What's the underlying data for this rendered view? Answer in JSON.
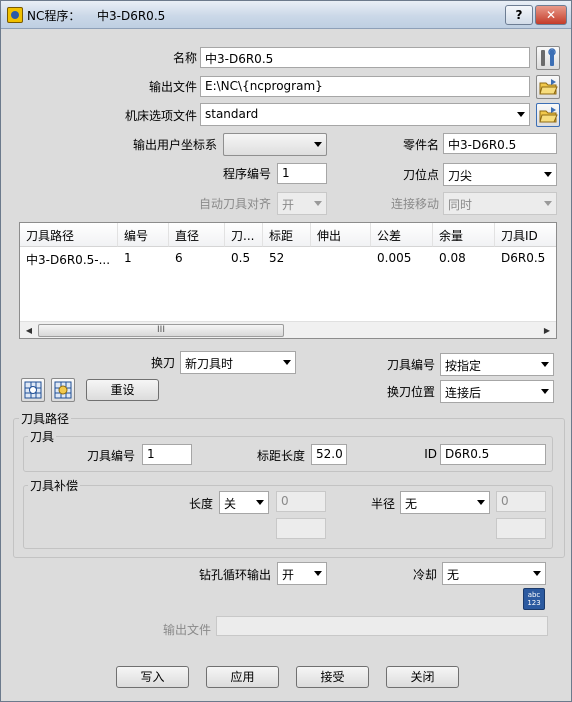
{
  "window": {
    "title": "NC程序：",
    "subtitle": "中3-D6R0.5",
    "help_label": "?",
    "close_label": "✕"
  },
  "fields": {
    "name_label": "名称",
    "name_value": "中3-D6R0.5",
    "output_file_label": "输出文件",
    "output_file_value": "E:\\NC\\{ncprogram}",
    "machine_option_label": "机床选项文件",
    "machine_option_value": "standard",
    "output_ucs_label": "输出用户坐标系",
    "output_ucs_value": "",
    "part_name_label": "零件名",
    "part_name_value": "中3-D6R0.5",
    "program_no_label": "程序编号",
    "program_no_value": "1",
    "tool_point_label": "刀位点",
    "tool_point_value": "刀尖",
    "auto_tool_align_label": "自动刀具对齐",
    "auto_tool_align_value": "开",
    "link_move_label": "连接移动",
    "link_move_value": "同时"
  },
  "table": {
    "columns": [
      "刀具路径",
      "编号",
      "直径",
      "刀...",
      "标距",
      "伸出",
      "公差",
      "余量",
      "刀具ID"
    ],
    "rows": [
      [
        "中3-D6R0.5-...",
        "1",
        "6",
        "0.5",
        "52",
        "",
        "0.005",
        "0.08",
        "D6R0.5"
      ]
    ],
    "scroll_grip": "III"
  },
  "tool_change": {
    "label": "换刀",
    "value": "新刀具时",
    "tool_number_label": "刀具编号",
    "tool_number_value": "按指定",
    "change_position_label": "换刀位置",
    "change_position_value": "连接后",
    "reset_label": "重设"
  },
  "toolpath_group": {
    "title": "刀具路径",
    "tool_group_title": "刀具",
    "tool_number_label": "刀具编号",
    "tool_number_value": "1",
    "gauge_length_label": "标距长度",
    "gauge_length_value": "52.0",
    "id_label": "ID",
    "id_value": "D6R0.5",
    "comp_group_title": "刀具补偿",
    "length_label": "长度",
    "length_value": "关",
    "length_num": "0",
    "radius_label": "半径",
    "radius_value": "无",
    "radius_num": "0"
  },
  "bottom": {
    "drill_cycle_label": "钻孔循环输出",
    "drill_cycle_value": "开",
    "coolant_label": "冷却",
    "coolant_value": "无",
    "abc_icon_text": "abc\n123",
    "output_file_label": "输出文件",
    "output_file_value": ""
  },
  "buttons": {
    "write": "写入",
    "apply": "应用",
    "accept": "接受",
    "close": "关闭"
  }
}
